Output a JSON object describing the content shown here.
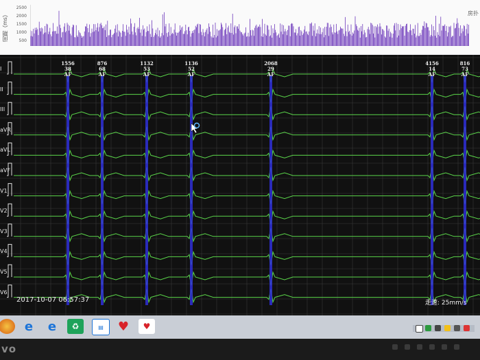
{
  "rr_panel": {
    "axis_label": "间期（ms）",
    "ticks": [
      "2500",
      "2000",
      "1500",
      "1000",
      "500"
    ],
    "corner_label": "房扑",
    "bar_color": "#5a1fb3"
  },
  "ecg": {
    "leads": [
      "I",
      "II",
      "III",
      "aVR",
      "aVL",
      "aVF",
      "V1",
      "V2",
      "V3",
      "V4",
      "V5",
      "V6"
    ],
    "beats": [
      {
        "interval": "1556",
        "rate": "38",
        "label": "AF"
      },
      {
        "interval": "876",
        "rate": "68",
        "label": "AF"
      },
      {
        "interval": "1132",
        "rate": "53",
        "label": "AF"
      },
      {
        "interval": "1136",
        "rate": "52",
        "label": "AF"
      },
      {
        "interval": "2068",
        "rate": "29",
        "label": "AF"
      },
      {
        "interval": "4156",
        "rate": "14",
        "label": "AF"
      },
      {
        "interval": "816",
        "rate": "73",
        "label": "AF"
      }
    ],
    "timestamp": "2017-10-07 06:57:37",
    "speed": "走速: 25mm/s",
    "trace_color": "#5bd64a",
    "marker_color": "#2f2fd8",
    "grid_color": "#3a3a3a"
  },
  "taskbar": {
    "icons": [
      "start-orb-icon",
      "ie-icon",
      "ie-alt-icon",
      "recycle-icon",
      "app-window-icon",
      "heart-app-icon",
      "heart-monitor-icon"
    ]
  },
  "bezel": {
    "brand": "vo"
  }
}
